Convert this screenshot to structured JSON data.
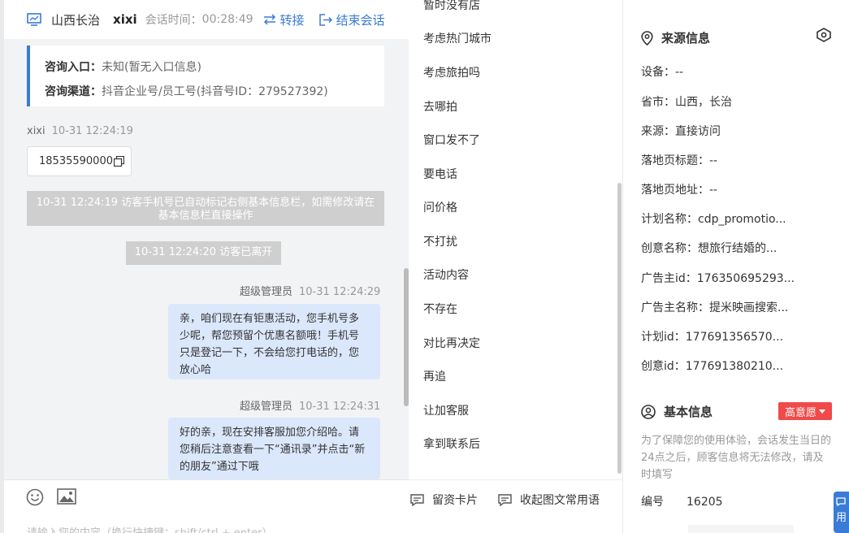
{
  "header": {
    "location": "山西长治",
    "user": "xixi",
    "duration_label": "会话时间：",
    "duration": "00:28:49",
    "transfer": "转接",
    "end": "结束会话"
  },
  "info_card": {
    "entry_label": "咨询入口：",
    "entry_value": "未知(暂无入口信息)",
    "channel_label": "咨询渠道：",
    "channel_value": "抖音企业号/员工号(抖音号ID：279527392)"
  },
  "messages": {
    "m1_sender": "xixi",
    "m1_time": "10-31 12:24:19",
    "phone": "18535590000",
    "sys1": "10-31 12:24:19 访客手机号已自动标记右侧基本信息栏，如需修改请在基本信息栏直接操作",
    "sys2": "10-31 12:24:20 访客已离开",
    "m2_sender": "超级管理员",
    "m2_time": "10-31 12:24:29",
    "m2_text": "亲，咱们现在有钜惠活动，您手机号多少呢，帮您预留个优惠名额哦！手机号只是登记一下，不会给您打电话的，您放心哈",
    "m3_sender": "超级管理员",
    "m3_time": "10-31 12:24:31",
    "m3_text": "好的亲，现在安排客服加您介绍哈。请您稍后注意查看一下“通讯录”并点击“新的朋友”通过下哦"
  },
  "input_placeholder": "请输入您的内容（换行快捷键：shift/ctrl + enter）",
  "quick_replies": [
    "暂时没有店",
    "考虑热门城市",
    "考虑旅拍吗",
    "去哪拍",
    "窗口发不了",
    "要电话",
    "问价格",
    "不打扰",
    "活动内容",
    "不存在",
    "对比再决定",
    "再追",
    "让加客服",
    "拿到联系后"
  ],
  "quick_footer": {
    "card": "留资卡片",
    "collapse": "收起图文常用语"
  },
  "source": {
    "title": "来源信息",
    "fields": [
      "设备：--",
      "省市：山西，长治",
      "来源：直接访问",
      "落地页标题：--",
      "落地页地址：--",
      "计划名称：cdp_promotio...",
      "创意名称：想旅行结婚的...",
      "广告主id：176350695293...",
      "广告主名称：提米映画搜索...",
      "计划id：177691356570...",
      "创意id：177691380210..."
    ]
  },
  "basic": {
    "title": "基本信息",
    "badge": "高意愿",
    "note": "为了保障您的使用体验，会话发生当日的24点之后，顾客信息将无法修改，请及时填写",
    "num_label": "编号",
    "num_value": "16205",
    "float_btn": "用"
  },
  "colors": {
    "accent": "#3a7bd5",
    "bubble": "#dbe7fb",
    "badge": "#f04a4a"
  }
}
